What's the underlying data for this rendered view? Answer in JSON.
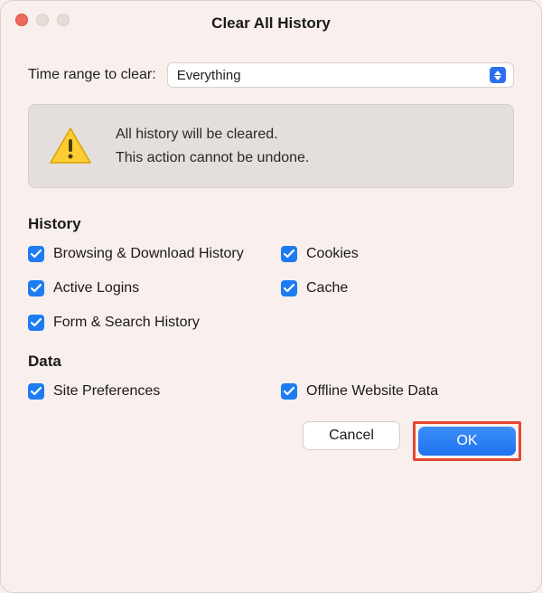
{
  "dialog": {
    "title": "Clear All History",
    "time_range_label": "Time range to clear:",
    "time_range_value": "Everything"
  },
  "warning": {
    "line1": "All history will be cleared.",
    "line2": "This action cannot be undone."
  },
  "sections": {
    "history": {
      "title": "History",
      "items": [
        {
          "label": "Browsing & Download History",
          "checked": true
        },
        {
          "label": "Cookies",
          "checked": true
        },
        {
          "label": "Active Logins",
          "checked": true
        },
        {
          "label": "Cache",
          "checked": true
        },
        {
          "label": "Form & Search History",
          "checked": true
        }
      ]
    },
    "data": {
      "title": "Data",
      "items": [
        {
          "label": "Site Preferences",
          "checked": true
        },
        {
          "label": "Offline Website Data",
          "checked": true
        }
      ]
    }
  },
  "buttons": {
    "cancel": "Cancel",
    "ok": "OK"
  }
}
